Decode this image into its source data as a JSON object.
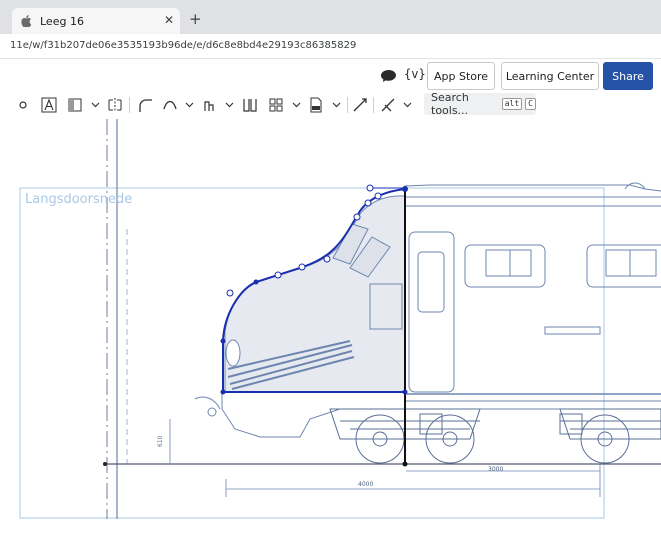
{
  "browser": {
    "tab_title": "Leeg 16",
    "close_glyph": "✕",
    "new_tab_glyph": "+",
    "url": "11e/w/f31b207de06e3535193b96de/e/d6c8e8bd4e29193c86385829"
  },
  "header": {
    "app_store_label": "App Store",
    "learning_center_label": "Learning Center",
    "share_label": "Share",
    "variables_label": "{v}"
  },
  "toolbar": {
    "search_placeholder": "Search tools...",
    "shortcut_alt": "alt",
    "shortcut_key": "C"
  },
  "canvas": {
    "sketch_label": "Langsdoorsnede",
    "dim_4000": "4000",
    "dim_3000": "3000"
  },
  "colors": {
    "primary": "#2452a6",
    "sketch": "#1a2fb0",
    "drawing": "#6d86b0",
    "frame": "#a9c8e6"
  }
}
